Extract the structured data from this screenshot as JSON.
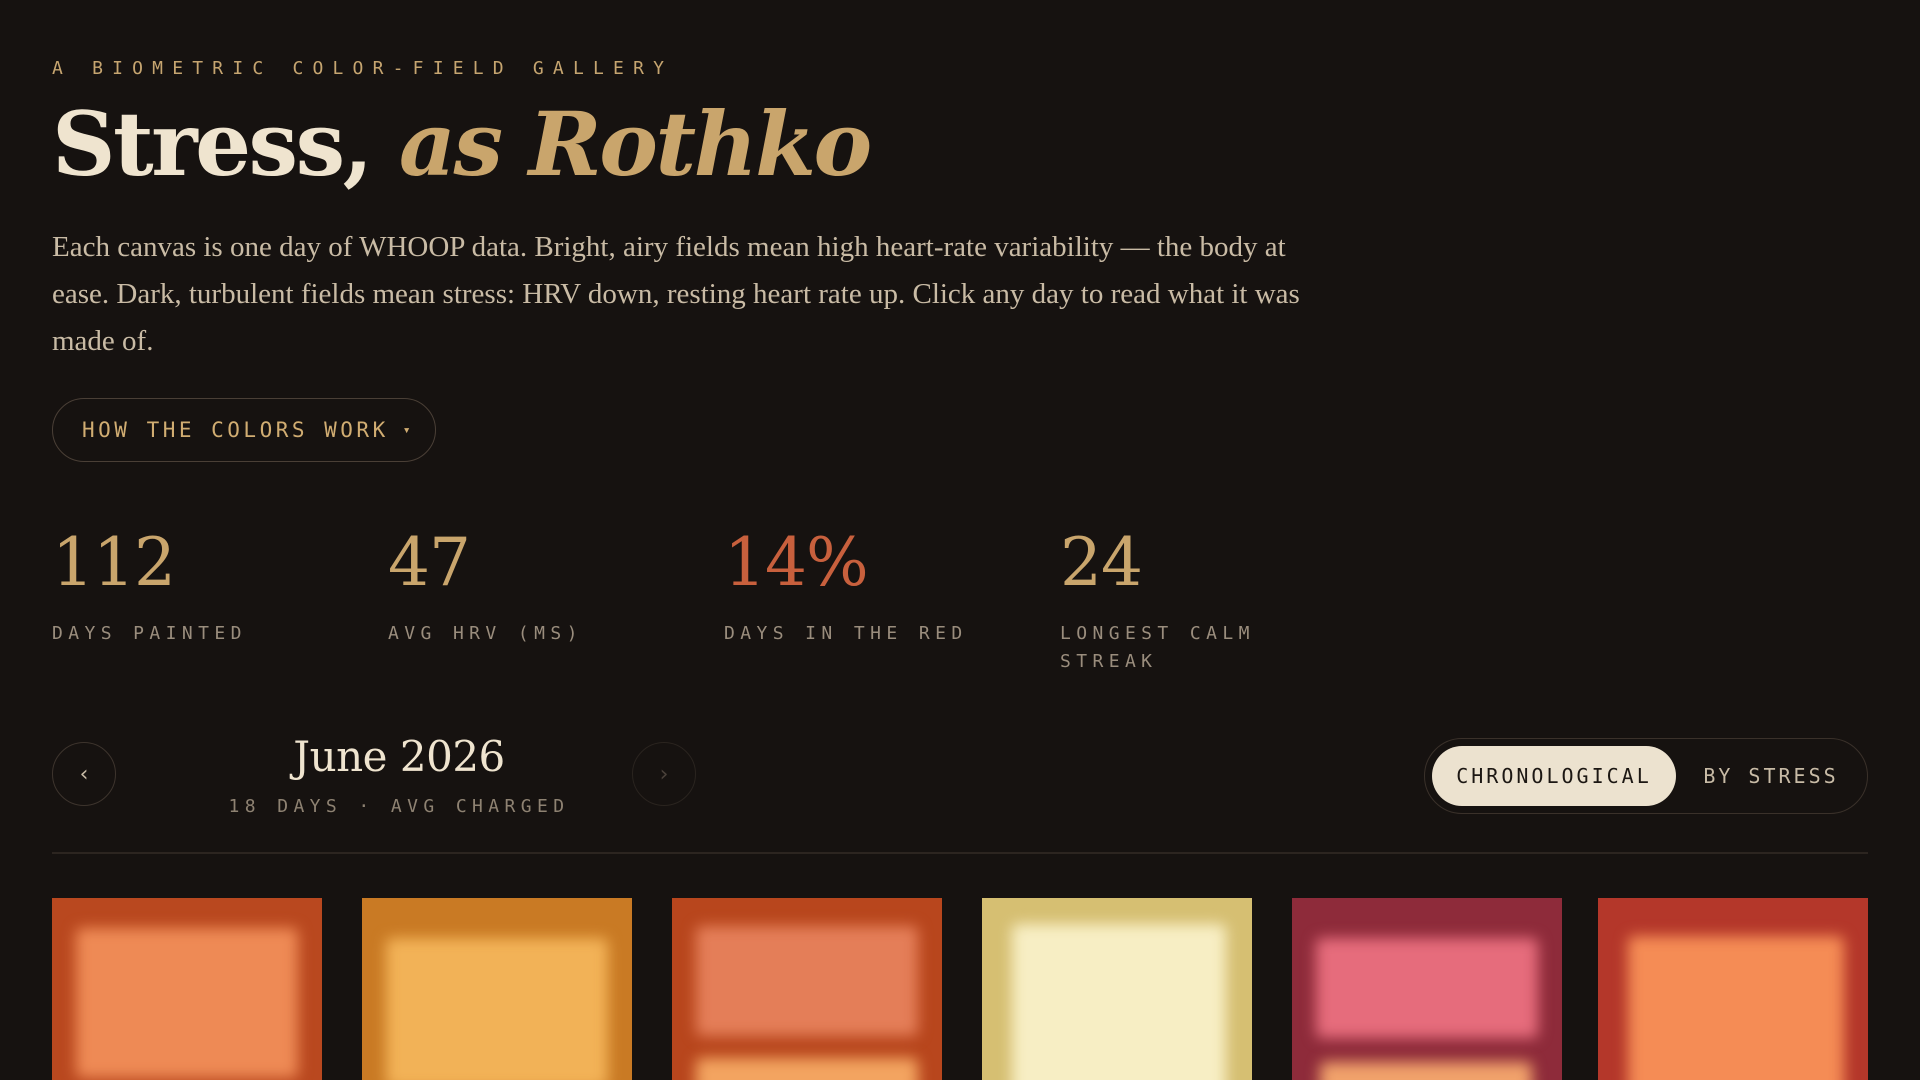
{
  "header": {
    "eyebrow": "A BIOMETRIC COLOR-FIELD GALLERY",
    "title_main": "Stress, ",
    "title_accent": "as Rothko",
    "intro": "Each canvas is one day of WHOOP data. Bright, airy fields mean high heart-rate variability — the body at ease. Dark, turbulent fields mean stress: HRV down, resting heart rate up. Click any day to read what it was made of.",
    "colors_button": "HOW THE COLORS WORK",
    "colors_caret": "▾"
  },
  "stats": [
    {
      "value": "112",
      "label": "DAYS PAINTED"
    },
    {
      "value": "47",
      "label": "AVG HRV (MS)"
    },
    {
      "value": "14%",
      "label": "DAYS IN THE RED"
    },
    {
      "value": "24",
      "label": "LONGEST CALM STREAK"
    }
  ],
  "month_nav": {
    "prev_icon": "‹",
    "next_icon": "›",
    "month": "June 2026",
    "summary": "18 DAYS · AVG CHARGED"
  },
  "sort_toggle": {
    "options": [
      "CHRONOLOGICAL",
      "BY STRESS"
    ],
    "selected": "CHRONOLOGICAL"
  },
  "canvases": [
    {
      "bg": "#b9481f",
      "top": "#ee8a55",
      "bottom": "#e88a52"
    },
    {
      "bg": "#c97a24",
      "top": "#f2b257",
      "bottom": "#f2b257"
    },
    {
      "bg": "#b8461d",
      "top": "#e47e58",
      "bottom": "#f3a460"
    },
    {
      "bg": "#d6bf72",
      "top": "#f7eec4",
      "bottom": "#f7eec4"
    },
    {
      "bg": "#8e2b3a",
      "top": "#e66c7c",
      "bottom": "#f1a26b"
    },
    {
      "bg": "#b4372a",
      "top": "#f58c55",
      "bottom": "#f58c55"
    }
  ]
}
